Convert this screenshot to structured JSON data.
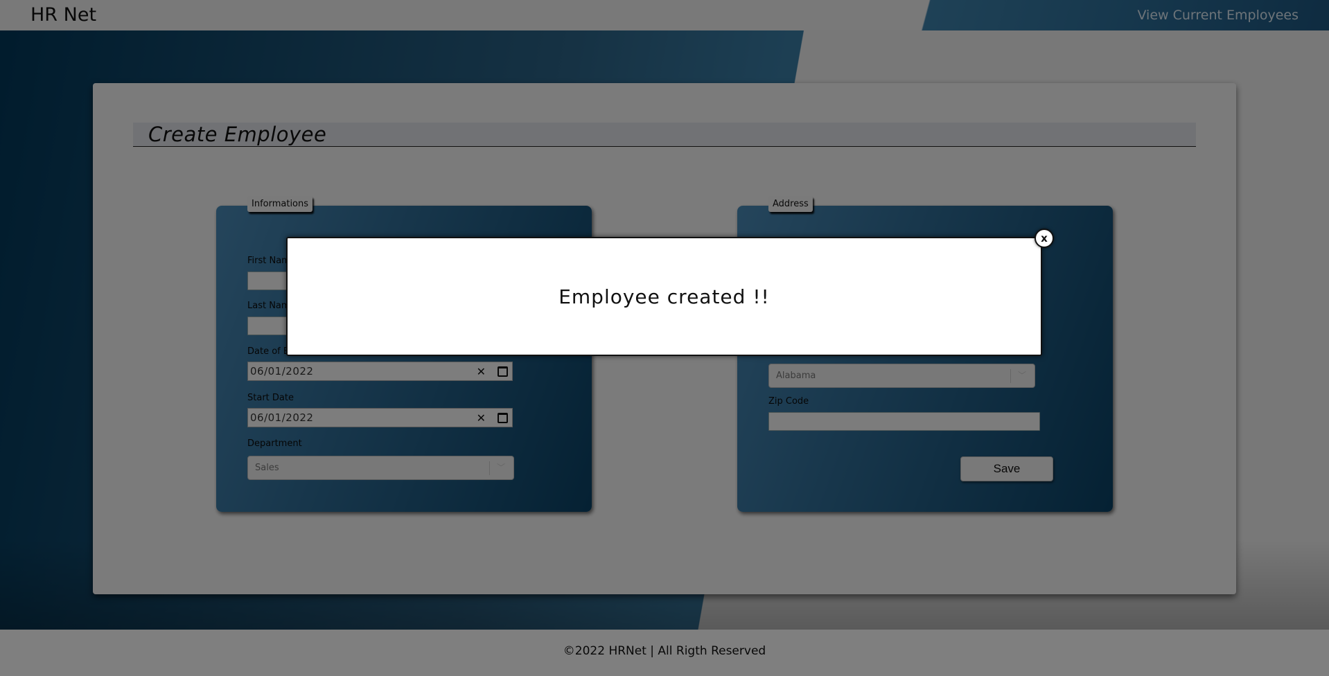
{
  "header": {
    "logo": "HR Net",
    "nav_link": "View Current Employees"
  },
  "main": {
    "title": "Create Employee"
  },
  "informations": {
    "legend": "Informations",
    "first_name_label": "First Name",
    "last_name_label": "Last Name",
    "birth_label": "Date of Birth",
    "birth_value": "06/01/2022",
    "start_label": "Start Date",
    "start_value": "06/01/2022",
    "department_label": "Department",
    "department_value": "Sales"
  },
  "address": {
    "legend": "Address",
    "state_value": "Alabama",
    "zip_label": "Zip Code",
    "save_label": "Save"
  },
  "footer": {
    "text": "©2022 HRNet | All Rigth Reserved"
  },
  "modal": {
    "message": "Employee created !!",
    "close_label": "x"
  }
}
